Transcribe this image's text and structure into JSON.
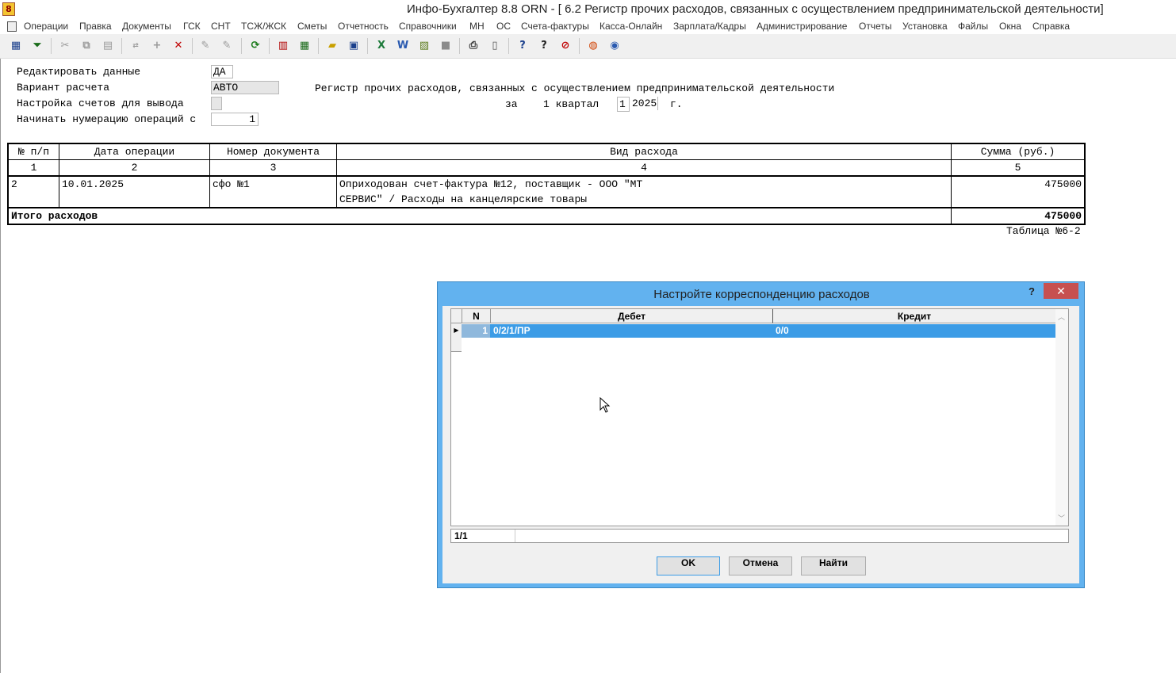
{
  "window": {
    "title": "Инфо-Бухгалтер 8.8   ORN   - [  6.2 Регистр прочих расходов, связанных с осуществлением предпринимательской деятельности]"
  },
  "menu": [
    "Операции",
    "Правка",
    "Документы",
    "ГСК",
    "СНТ",
    "ТСЖ/ЖСК",
    "Сметы",
    "Отчетность",
    "Справочники",
    "МН",
    "ОС",
    "Счета-фактуры",
    "Касса-Онлайн",
    "Зарплата/Кадры",
    "Администрирование",
    "Отчеты",
    "Установка",
    "Файлы",
    "Окна",
    "Справка"
  ],
  "form": {
    "edit_label": "Редактировать данные",
    "edit_value": "ДА",
    "variant_label": "Вариант расчета",
    "variant_value": "АВТО",
    "accounts_label": "Настройка счетов для вывода",
    "numbering_label": "Начинать нумерацию операций с",
    "numbering_value": "1"
  },
  "register": {
    "title": "Регистр прочих расходов, связанных с осуществлением предпринимательской деятельности",
    "period_prefix": "за",
    "period_text": "1 квартал",
    "quarter": "1",
    "year": "2025",
    "year_suffix": "г.",
    "columns": [
      "№ п/п",
      "Дата операции",
      "Номер документа",
      "Вид расхода",
      "Сумма (руб.)"
    ],
    "column_numbers": [
      "1",
      "2",
      "3",
      "4",
      "5"
    ],
    "rows": [
      {
        "num": "2",
        "date": "10.01.2025",
        "doc": "сфо №1",
        "desc_line1": "Оприходован счет-фактура №12, поставщик - ООО \"МТ",
        "desc_line2": "СЕРВИС\" / Расходы на канцелярские товары",
        "sum": "475000"
      }
    ],
    "total_label": "Итого расходов",
    "total_sum": "475000",
    "table_ref": "Таблица №6-2"
  },
  "dialog": {
    "title": "Настройте корреспонденцию расходов",
    "help": "?",
    "close": "✕",
    "columns": [
      "N",
      "Дебет",
      "Кредит"
    ],
    "rows": [
      {
        "n": "1",
        "debit": "0/2/1/ПР",
        "credit": "0/0"
      }
    ],
    "status": "1/1",
    "ok": "OK",
    "cancel": "Отмена",
    "find": "Найти"
  }
}
